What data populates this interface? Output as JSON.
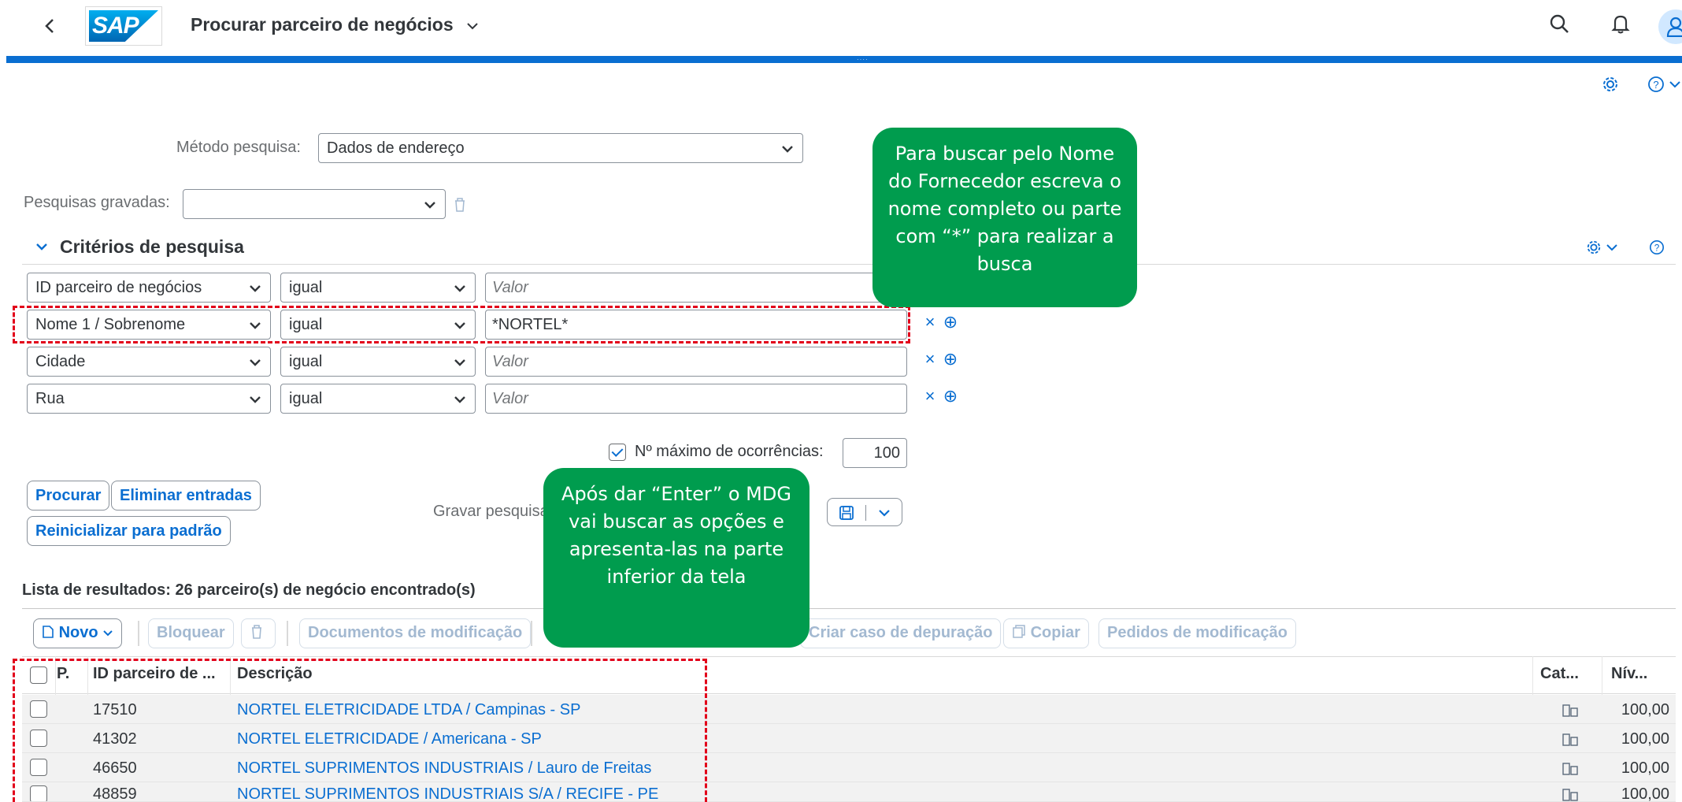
{
  "shell": {
    "app_title": "Procurar parceiro de negócios",
    "logo_text": "SAP",
    "icons": [
      "back-icon",
      "search-icon",
      "bell-icon",
      "user-icon"
    ]
  },
  "toolbar": {
    "icons": [
      "gear-icon",
      "help-icon",
      "chevron-down-icon"
    ]
  },
  "search": {
    "method_label": "Método pesquisa:",
    "method_value": "Dados de endereço",
    "saved_label": "Pesquisas gravadas:",
    "saved_value": "",
    "panel_title": "Critérios de pesquisa",
    "criteria": [
      {
        "field": "ID parceiro de negócios",
        "operator": "igual",
        "value": "",
        "placeholder": "Valor"
      },
      {
        "field": "Nome 1 / Sobrenome",
        "operator": "igual",
        "value": "*NORTEL*",
        "placeholder": "Valor"
      },
      {
        "field": "Cidade",
        "operator": "igual",
        "value": "",
        "placeholder": "Valor"
      },
      {
        "field": "Rua",
        "operator": "igual",
        "value": "",
        "placeholder": "Valor"
      }
    ],
    "row_actions": {
      "remove": "×",
      "add": "⊕"
    },
    "max_label": "Nº máximo de ocorrências:",
    "max_checked": true,
    "max_value": "100",
    "buttons": {
      "search": "Procurar",
      "clear": "Eliminar entradas",
      "reset": "Reinicializar para padrão"
    },
    "save_label": "Gravar pesquisa"
  },
  "results": {
    "title": "Lista de resultados: 26 parceiro(s) de negócio encontrado(s)",
    "toolbar": {
      "new": "Novo",
      "block": "Bloquear",
      "change_docs": "Documentos de modificação",
      "debug_case": "Criar caso de depuração",
      "copy": "Copiar",
      "change_requests": "Pedidos de modificação"
    },
    "columns": [
      "P.",
      "ID parceiro de ...",
      "Descrição",
      "Cat...",
      "Nív..."
    ],
    "rows": [
      {
        "id": "17510",
        "description": "NORTEL ELETRICIDADE LTDA / Campinas - SP",
        "level": "100,00"
      },
      {
        "id": "41302",
        "description": "NORTEL ELETRICIDADE / Americana - SP",
        "level": "100,00"
      },
      {
        "id": "46650",
        "description": "NORTEL SUPRIMENTOS INDUSTRIAIS / Lauro de Freitas",
        "level": "100,00"
      },
      {
        "id": "48859",
        "description": "NORTEL SUPRIMENTOS INDUSTRIAIS S/A / RECIFE - PE",
        "level": "100,00"
      }
    ]
  },
  "callouts": {
    "top": "Para buscar pelo Nome do Fornecedor escreva o nome completo ou parte com “*” para realizar a busca",
    "bottom": "Após dar “Enter” o MDG vai buscar as opções e apresenta-las na parte inferior da tela"
  },
  "colors": {
    "accent": "#0a6ed1",
    "callout": "#009c4e",
    "highlight": "#e2001a"
  }
}
